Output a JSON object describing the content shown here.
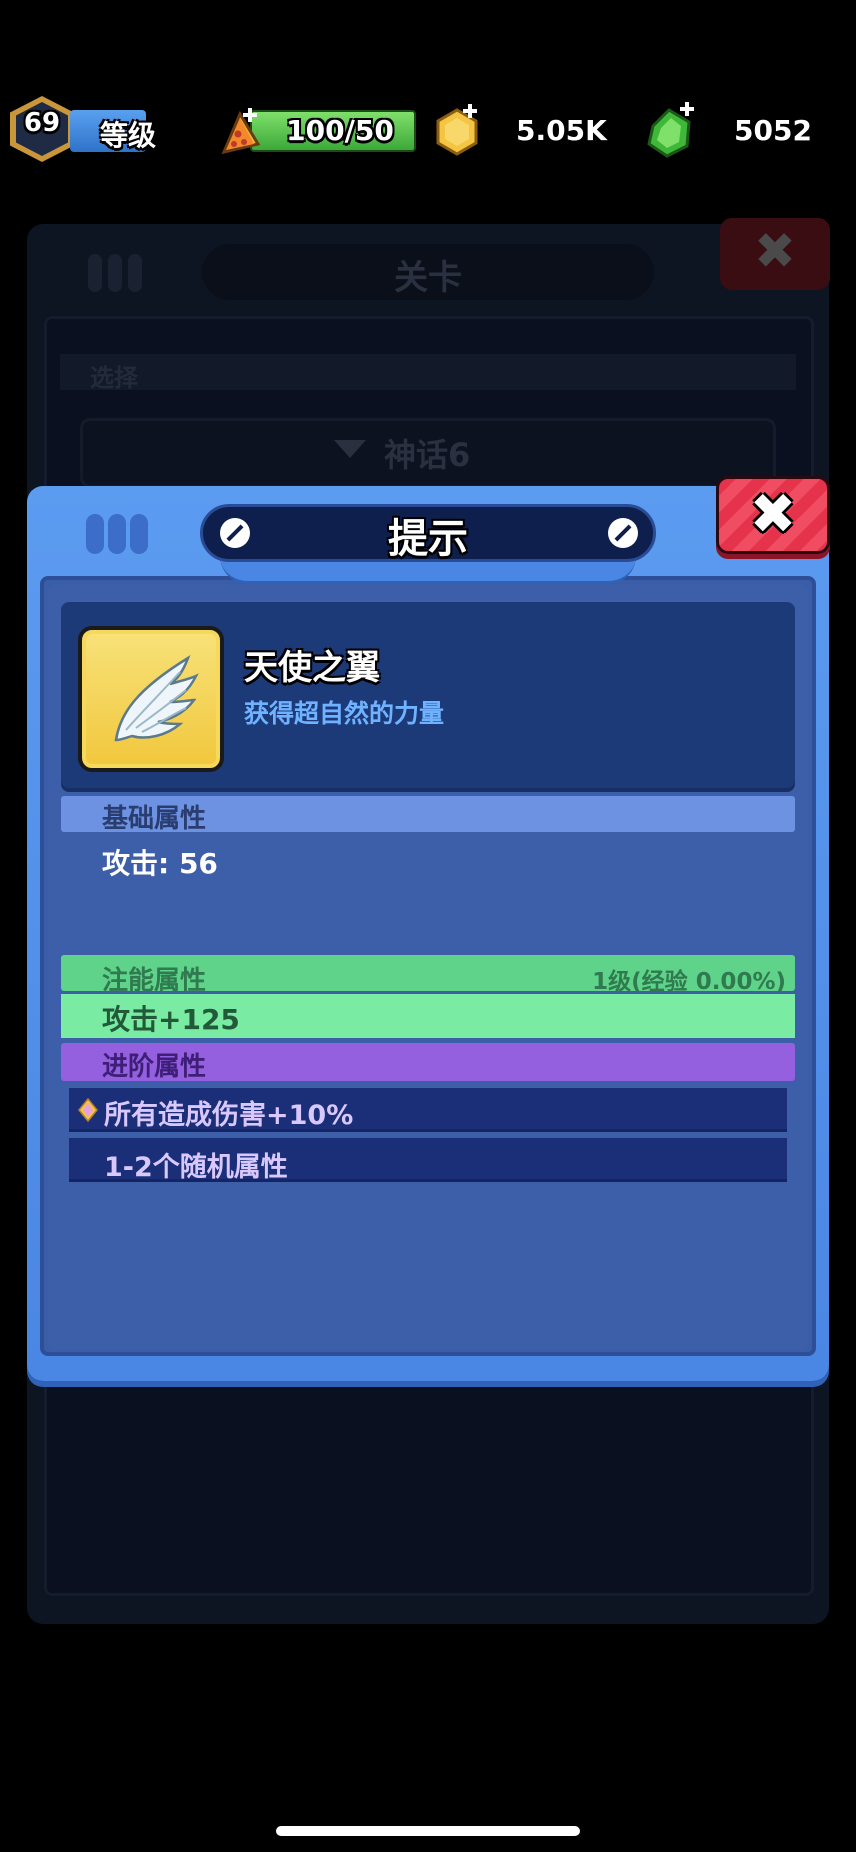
{
  "top_bar": {
    "level": "69",
    "level_label": "等级",
    "stamina": "100/50",
    "coins": "5.05K",
    "gems": "5052"
  },
  "background_window": {
    "title": "关卡",
    "select_label": "选择",
    "dropdown_value": "神话6"
  },
  "dialog": {
    "title": "提示",
    "close": "✖",
    "item": {
      "name": "天使之翼",
      "description": "获得超自然的力量",
      "icon": "angel-wing-icon"
    },
    "base_attributes": {
      "header": "基础属性",
      "value": "攻击: 56"
    },
    "charge_attributes": {
      "header": "注能属性",
      "level": "1级(经验 0.00%)",
      "value": "攻击+125"
    },
    "advanced_attributes": {
      "header": "进阶属性",
      "rows": [
        "所有造成伤害+10%",
        "1-2个随机属性"
      ]
    }
  },
  "colors": {
    "dialog_blue": "#4a86e3",
    "body_blue": "#3d5faa",
    "base_header": "#6d92e2",
    "charge_header": "#5fd38a",
    "advanced_header": "#9560e0",
    "close_red": "#e4334a",
    "item_icon_gold": "#f1c73c"
  }
}
